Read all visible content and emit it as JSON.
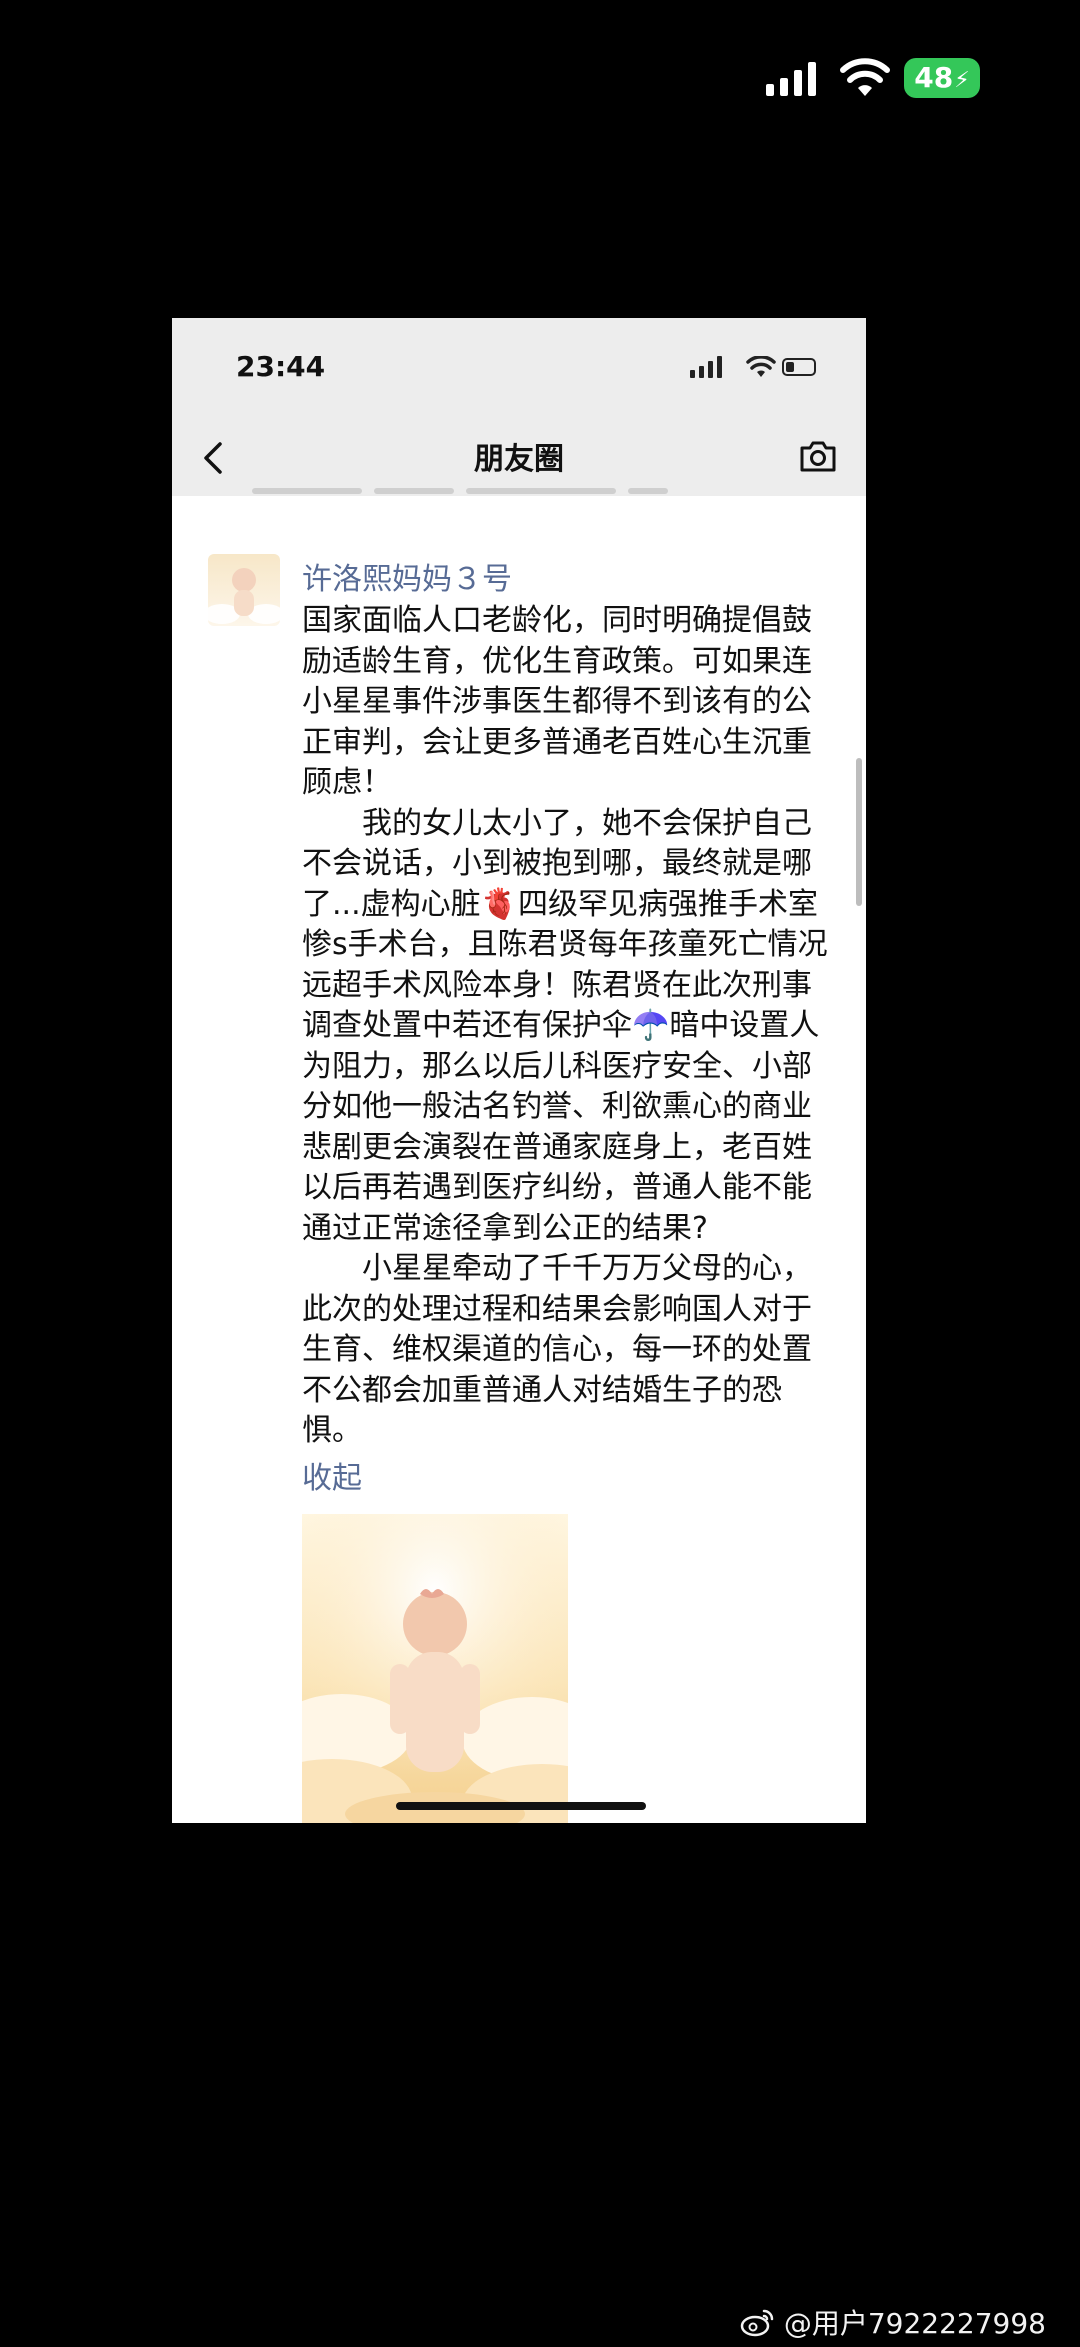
{
  "outer_status": {
    "battery": "48",
    "battery_color": "#34c759"
  },
  "inner_status": {
    "time": "23:44"
  },
  "nav": {
    "title": "朋友圈",
    "back_icon": "chevron-left-icon",
    "camera_icon": "camera-icon"
  },
  "post": {
    "author": "许洛熙妈妈３号",
    "paragraphs": [
      "国家面临人口老龄化，同时明确提倡鼓励适龄生育，优化生育政策。可如果连小星星事件涉事医生都得不到该有的公正审判，会让更多普通老百姓心生沉重顾虑！",
      "我的女儿太小了，她不会保护自己不会说话，小到被抱到哪，最终就是哪了...虚构心脏🫀四级罕见病强推手术室惨s手术台，且陈君贤每年孩童死亡情况远超手术风险本身！陈君贤在此次刑事调查处置中若还有保护伞☂️暗中设置人为阻力，那么以后儿科医疗安全、小部分如他一般沽名钓誉、利欲熏心的商业悲剧更会演裂在普通家庭身上，老百姓以后再若遇到医疗纠纷，普通人能不能通过正常途径拿到公正的结果?",
      "小星星牵动了千千万万父母的心，此次的处理过程和结果会影响国人对于生育、维权渠道的信心，每一环的处置不公都会加重普通人对结婚生子的恐惧。"
    ],
    "collapse_label": "收起",
    "link_color": "#576b95"
  },
  "watermark": {
    "text": "@用户7922227998"
  }
}
